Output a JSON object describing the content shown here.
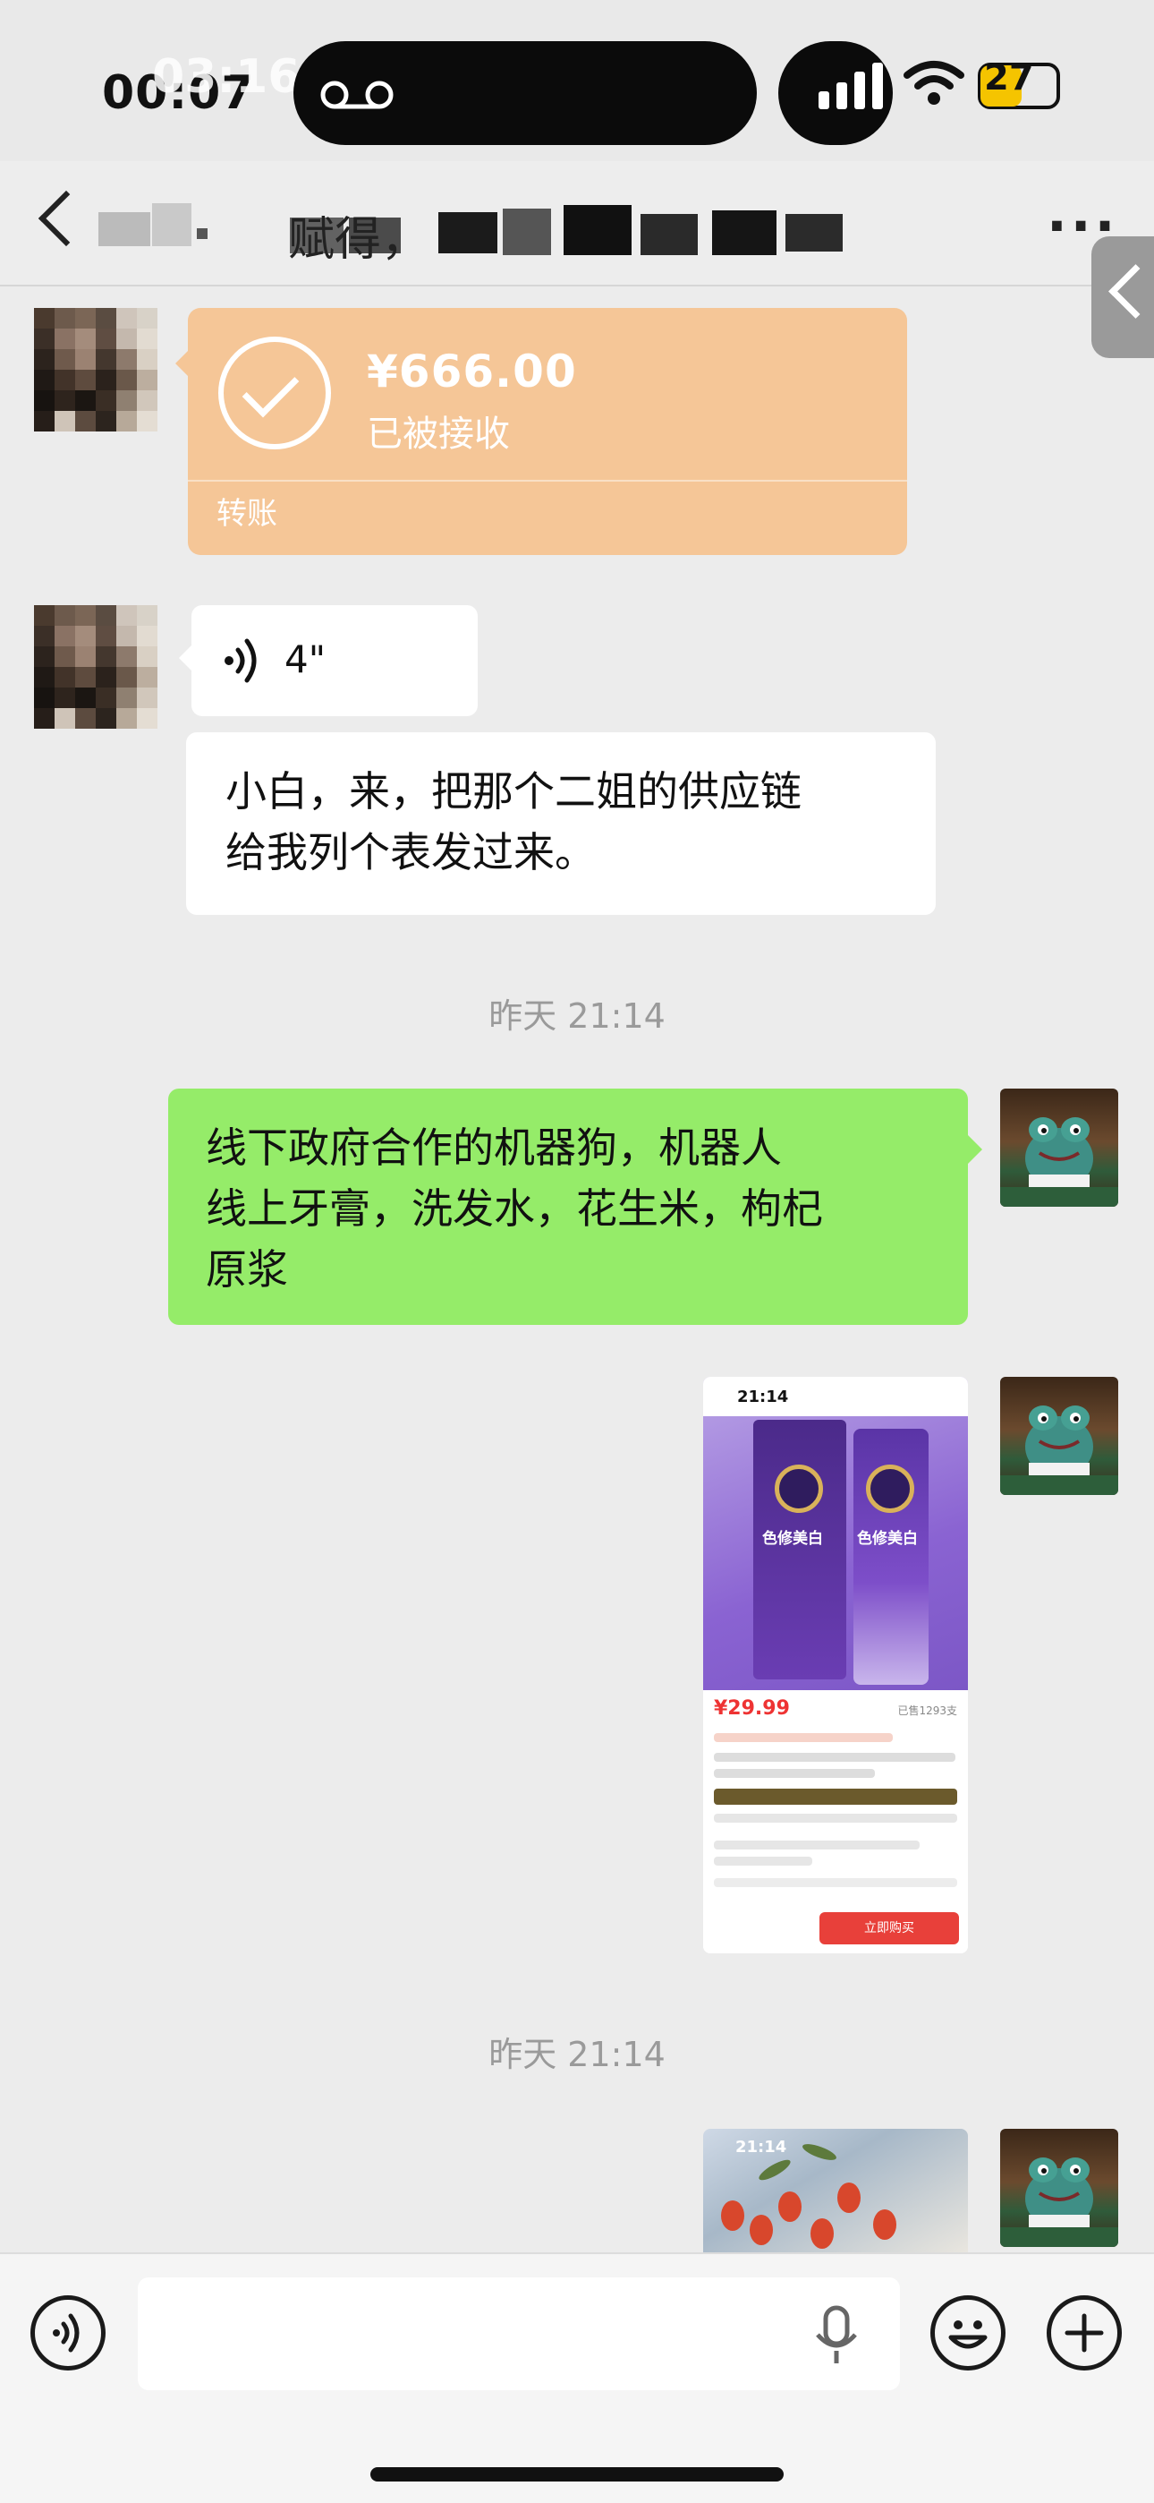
{
  "status_bar": {
    "time": "00:07",
    "time_overlay": "03:16",
    "battery": "27"
  },
  "header": {
    "title_visible_fragment": "赋得，"
  },
  "messages": {
    "transfer": {
      "amount": "¥666.00",
      "status": "已被接收",
      "label": "转账"
    },
    "voice": {
      "duration": "4\""
    },
    "text_left": "小白，来，把那个二姐的供应链\n给我列个表发过来。",
    "timestamp_1": "昨天 21:14",
    "text_right": "线下政府合作的机器狗，机器人\n线上牙膏，洗发水，花生米，枸杞\n原浆",
    "product_image": {
      "time": "21:14",
      "brand_left": "色修美白",
      "brand_right": "色修美白",
      "price": "¥29.99",
      "sold": "已售1293支",
      "buy_label": "立即购买"
    },
    "timestamp_2": "昨天 21:14",
    "goji_image": {
      "time": "21:14"
    }
  },
  "input": {
    "placeholder": ""
  }
}
